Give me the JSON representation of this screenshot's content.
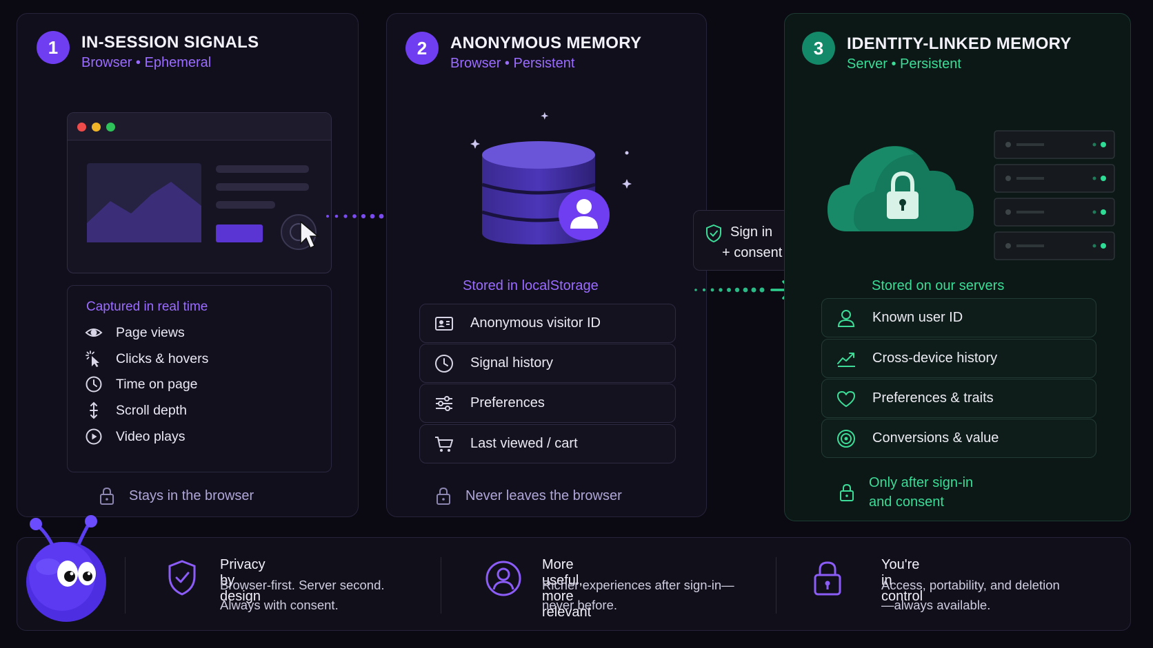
{
  "colors": {
    "purple": "#6f3ef0",
    "purple_text": "#9a6cff",
    "green": "#14896a",
    "green_text": "#3ddc98",
    "background": "#0b0a13"
  },
  "panel1": {
    "number": "1",
    "title": "IN-SESSION SIGNALS",
    "subtitle_a": "Browser",
    "subtitle_b": "Ephemeral",
    "captured_heading": "Captured in real time",
    "items": [
      {
        "label": "Page views",
        "icon": "eye-icon"
      },
      {
        "label": "Clicks & hovers",
        "icon": "click-icon"
      },
      {
        "label": "Time on page",
        "icon": "clock-icon"
      },
      {
        "label": "Scroll depth",
        "icon": "scroll-icon"
      },
      {
        "label": "Video plays",
        "icon": "play-icon"
      }
    ],
    "footer": "Stays in the browser"
  },
  "panel2": {
    "number": "2",
    "title": "ANONYMOUS MEMORY",
    "subtitle_a": "Browser",
    "subtitle_b": "Persistent",
    "stored": "Stored in localStorage",
    "items": [
      {
        "label": "Anonymous visitor ID",
        "icon": "id-card-icon"
      },
      {
        "label": "Signal history",
        "icon": "clock-icon"
      },
      {
        "label": "Preferences",
        "icon": "sliders-icon"
      },
      {
        "label": "Last viewed / cart",
        "icon": "cart-icon"
      }
    ],
    "footer": "Never leaves the browser"
  },
  "signin": {
    "line1": "Sign in",
    "line2": "+ consent"
  },
  "panel3": {
    "number": "3",
    "title": "IDENTITY-LINKED MEMORY",
    "subtitle_a": "Server",
    "subtitle_b": "Persistent",
    "stored": "Stored on our servers",
    "items": [
      {
        "label": "Known user ID",
        "icon": "user-icon"
      },
      {
        "label": "Cross-device history",
        "icon": "chart-line-icon"
      },
      {
        "label": "Preferences & traits",
        "icon": "heart-icon"
      },
      {
        "label": "Conversions & value",
        "icon": "target-icon"
      }
    ],
    "footer_line1": "Only after sign-in",
    "footer_line2": "and consent"
  },
  "bottom": [
    {
      "title": "Privacy by design",
      "line1": "Browser-first. Server second.",
      "line2": "Always with consent.",
      "icon": "shield-check-icon"
    },
    {
      "title": "More useful, more relevant",
      "line1": "Richer experiences after sign-in—",
      "line2": "never before.",
      "icon": "user-circle-icon"
    },
    {
      "title": "You're in control",
      "line1": "Access, portability, and deletion",
      "line2": "—always available.",
      "icon": "padlock-icon"
    }
  ]
}
